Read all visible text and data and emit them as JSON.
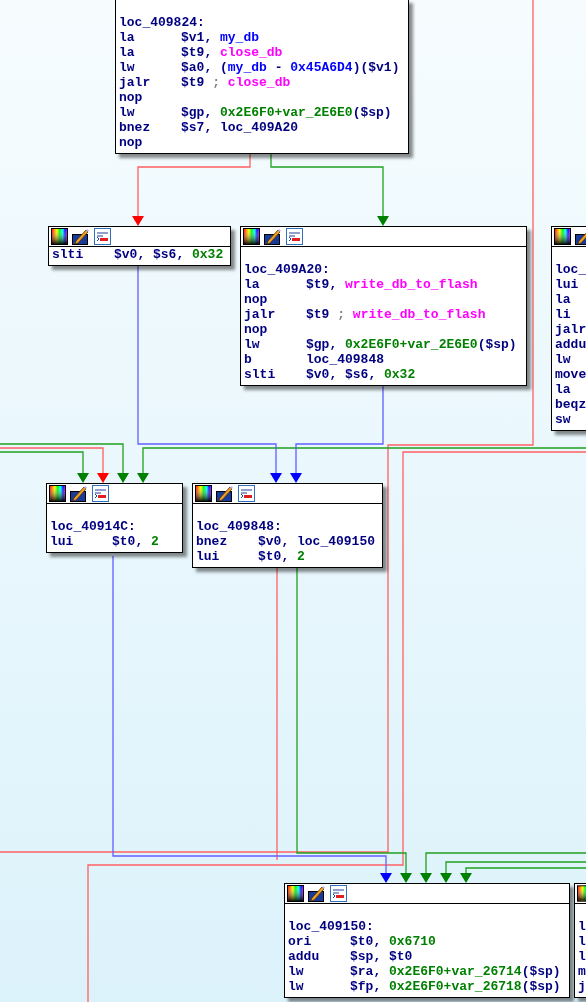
{
  "blocks": [
    {
      "toolbar": false,
      "lines": [
        {
          "kind": "blank"
        },
        {
          "kind": "label",
          "text": "loc_409824:"
        },
        {
          "kind": "instr",
          "op": "la",
          "args": [
            {
              "text": "$v1, ",
              "kind": "reg"
            },
            {
              "text": "my_db",
              "kind": "data"
            }
          ]
        },
        {
          "kind": "instr",
          "op": "la",
          "args": [
            {
              "text": "$t9, ",
              "kind": "reg"
            },
            {
              "text": "close_db",
              "kind": "func"
            }
          ]
        },
        {
          "kind": "instr",
          "op": "lw",
          "args": [
            {
              "text": "$a0, (",
              "kind": "reg"
            },
            {
              "text": "my_db",
              "kind": "data"
            },
            {
              "text": " - ",
              "kind": "reg"
            },
            {
              "text": "0x45A6D4",
              "kind": "data"
            },
            {
              "text": ")($v1)",
              "kind": "reg"
            }
          ]
        },
        {
          "kind": "instr",
          "op": "jalr",
          "args": [
            {
              "text": "$t9 ",
              "kind": "reg"
            },
            {
              "text": ";",
              "kind": "comment"
            },
            {
              "text": " close_db",
              "kind": "func"
            }
          ]
        },
        {
          "kind": "instr",
          "op": "nop"
        },
        {
          "kind": "instr",
          "op": "lw",
          "args": [
            {
              "text": "$gp, ",
              "kind": "reg"
            },
            {
              "text": "0x2E6F0+var_2E6E0",
              "kind": "num"
            },
            {
              "text": "($sp)",
              "kind": "reg"
            }
          ]
        },
        {
          "kind": "instr",
          "op": "bnez",
          "args": [
            {
              "text": "$s7, loc_409A20",
              "kind": "reg"
            }
          ]
        },
        {
          "kind": "instr",
          "op": "nop"
        }
      ]
    },
    {
      "toolbar": true,
      "lines": [
        {
          "kind": "instr",
          "op": "slti",
          "args": [
            {
              "text": "$v0, $s6, ",
              "kind": "reg"
            },
            {
              "text": "0x32",
              "kind": "num"
            }
          ]
        }
      ]
    },
    {
      "toolbar": true,
      "lines": [
        {
          "kind": "blank"
        },
        {
          "kind": "label",
          "text": "loc_409A20:"
        },
        {
          "kind": "instr",
          "op": "la",
          "args": [
            {
              "text": "$t9, ",
              "kind": "reg"
            },
            {
              "text": "write_db_to_flash",
              "kind": "func"
            }
          ]
        },
        {
          "kind": "instr",
          "op": "nop"
        },
        {
          "kind": "instr",
          "op": "jalr",
          "args": [
            {
              "text": "$t9 ",
              "kind": "reg"
            },
            {
              "text": ";",
              "kind": "comment"
            },
            {
              "text": " write_db_to_flash",
              "kind": "func"
            }
          ]
        },
        {
          "kind": "instr",
          "op": "nop"
        },
        {
          "kind": "instr",
          "op": "lw",
          "args": [
            {
              "text": "$gp, ",
              "kind": "reg"
            },
            {
              "text": "0x2E6F0+var_2E6E0",
              "kind": "num"
            },
            {
              "text": "($sp)",
              "kind": "reg"
            }
          ]
        },
        {
          "kind": "instr",
          "op": "b",
          "args": [
            {
              "text": "loc_409848",
              "kind": "reg"
            }
          ]
        },
        {
          "kind": "instr",
          "op": "slti",
          "args": [
            {
              "text": "$v0, $s6, ",
              "kind": "reg"
            },
            {
              "text": "0x32",
              "kind": "num"
            }
          ]
        }
      ]
    },
    {
      "toolbar": true,
      "lines": [
        {
          "kind": "blank"
        },
        {
          "kind": "label",
          "text": "loc_"
        },
        {
          "kind": "instr",
          "op": "lui"
        },
        {
          "kind": "instr",
          "op": "la"
        },
        {
          "kind": "instr",
          "op": "li"
        },
        {
          "kind": "instr",
          "op": "jalr"
        },
        {
          "kind": "instr",
          "op": "addu"
        },
        {
          "kind": "instr",
          "op": "lw"
        },
        {
          "kind": "instr",
          "op": "move"
        },
        {
          "kind": "instr",
          "op": "la"
        },
        {
          "kind": "instr",
          "op": "beqz"
        },
        {
          "kind": "instr",
          "op": "sw"
        }
      ]
    },
    {
      "toolbar": true,
      "lines": [
        {
          "kind": "blank"
        },
        {
          "kind": "label",
          "text": "loc_40914C:"
        },
        {
          "kind": "instr",
          "op": "lui",
          "args": [
            {
              "text": "$t0, ",
              "kind": "reg"
            },
            {
              "text": "2",
              "kind": "num"
            }
          ]
        }
      ]
    },
    {
      "toolbar": true,
      "lines": [
        {
          "kind": "blank"
        },
        {
          "kind": "label",
          "text": "loc_409848:"
        },
        {
          "kind": "instr",
          "op": "bnez",
          "args": [
            {
              "text": "$v0, loc_409150",
              "kind": "reg"
            }
          ]
        },
        {
          "kind": "instr",
          "op": "lui",
          "args": [
            {
              "text": "$t0, ",
              "kind": "reg"
            },
            {
              "text": "2",
              "kind": "num"
            }
          ]
        }
      ]
    },
    {
      "toolbar": true,
      "lines": [
        {
          "kind": "blank"
        },
        {
          "kind": "label",
          "text": "loc_409150:"
        },
        {
          "kind": "instr",
          "op": "ori",
          "args": [
            {
              "text": "$t0, ",
              "kind": "reg"
            },
            {
              "text": "0x6710",
              "kind": "num"
            }
          ]
        },
        {
          "kind": "instr",
          "op": "addu",
          "args": [
            {
              "text": "$sp, $t0",
              "kind": "reg"
            }
          ]
        },
        {
          "kind": "instr",
          "op": "lw",
          "args": [
            {
              "text": "$ra, ",
              "kind": "reg"
            },
            {
              "text": "0x2E6F0+var_26714",
              "kind": "num"
            },
            {
              "text": "($sp)",
              "kind": "reg"
            }
          ]
        },
        {
          "kind": "instr",
          "op": "lw",
          "args": [
            {
              "text": "$fp, ",
              "kind": "reg"
            },
            {
              "text": "0x2E6F0+var_26718",
              "kind": "num"
            },
            {
              "text": "($sp)",
              "kind": "reg"
            }
          ]
        }
      ]
    },
    {
      "toolbar": true,
      "lines": [
        {
          "kind": "blank"
        },
        {
          "kind": "instr",
          "op": "l"
        },
        {
          "kind": "instr",
          "op": "l"
        },
        {
          "kind": "instr",
          "op": "l"
        },
        {
          "kind": "instr",
          "op": "m"
        },
        {
          "kind": "instr",
          "op": "j"
        }
      ]
    }
  ]
}
